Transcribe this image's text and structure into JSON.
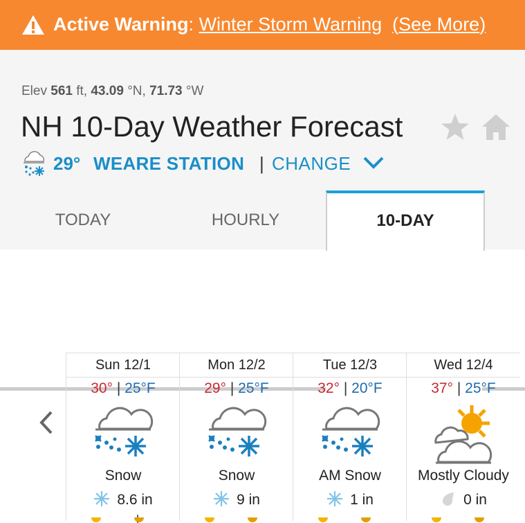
{
  "banner": {
    "prefix": "Active Warning",
    "colon": ":",
    "warning_link": "Winter Storm Warning",
    "see_more_open": "(",
    "see_more": "See More",
    "see_more_close": ")",
    "icon": "warning-triangle-icon",
    "color": "#f7882f"
  },
  "location": {
    "elev_label": "Elev",
    "elev_value": "561",
    "elev_unit": "ft,",
    "lat_value": "43.09",
    "lat_unit": "°N,",
    "lon_value": "71.73",
    "lon_unit": "°W",
    "title": "NH 10-Day Weather Forecast"
  },
  "station": {
    "current_temp": "29°",
    "name": "WEARE STATION",
    "separator": "|",
    "change_label": "CHANGE",
    "current_icon": "cloud-snow-icon",
    "accent": "#1a8ec8"
  },
  "tabs": [
    {
      "label": "TODAY"
    },
    {
      "label": "HOURLY"
    },
    {
      "label": "10-DAY",
      "selected": true
    }
  ],
  "forecast": [
    {
      "date": "Sun 12/1",
      "hi": "30°",
      "sep": "|",
      "lo": "25°F",
      "condition": "Snow",
      "precip": "8.6 in",
      "icon": "snow-icon",
      "precip_icon": "snowflake-icon"
    },
    {
      "date": "Mon 12/2",
      "hi": "29°",
      "sep": "|",
      "lo": "25°F",
      "condition": "Snow",
      "precip": "9 in",
      "icon": "snow-icon",
      "precip_icon": "snowflake-icon"
    },
    {
      "date": "Tue 12/3",
      "hi": "32°",
      "sep": "|",
      "lo": "20°F",
      "condition": "AM Snow",
      "precip": "1 in",
      "icon": "snow-icon",
      "precip_icon": "snowflake-icon"
    },
    {
      "date": "Wed 12/4",
      "hi": "37°",
      "sep": "|",
      "lo": "25°F",
      "condition": "Mostly Cloudy",
      "precip": "0 in",
      "icon": "mostly-cloudy-icon",
      "precip_icon": "raindrop-icon"
    }
  ],
  "colors": {
    "high": "#c9272d",
    "low": "#1c6bb0",
    "tab_accent": "#1a9fd8"
  }
}
